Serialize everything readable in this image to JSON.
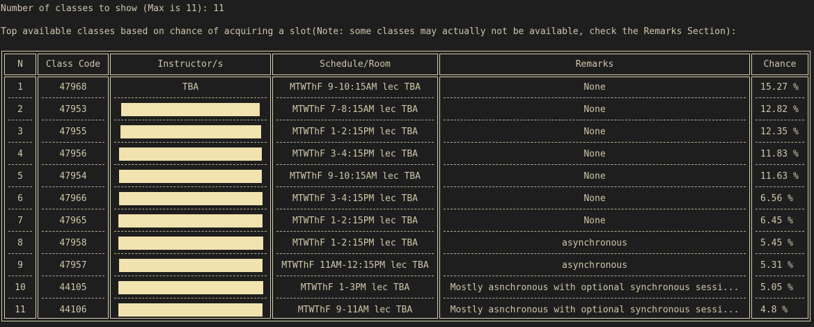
{
  "prompt": {
    "label": "Number of classes to show (Max is 11): 11"
  },
  "note": {
    "text": "Top available classes based on chance of acquiring a slot(Note: some classes may actually not be available, check the Remarks Section):"
  },
  "table": {
    "headers": [
      "N",
      "Class Code",
      "Instructor/s",
      "Schedule/Room",
      "Remarks",
      "Chance"
    ],
    "rows": [
      {
        "n": "1",
        "code": "47968",
        "instructor": "TBA",
        "instructor_redacted": false,
        "schedule": "MTWThF 9-10:15AM lec TBA",
        "remarks": "None",
        "chance": "15.27 %"
      },
      {
        "n": "2",
        "code": "47953",
        "instructor": "",
        "instructor_redacted": true,
        "schedule": "MTWThF 7-8:15AM lec TBA",
        "remarks": "None",
        "chance": "12.82 %"
      },
      {
        "n": "3",
        "code": "47955",
        "instructor": "",
        "instructor_redacted": true,
        "schedule": "MTWThF 1-2:15PM lec TBA",
        "remarks": "None",
        "chance": "12.35 %"
      },
      {
        "n": "4",
        "code": "47956",
        "instructor": "",
        "instructor_redacted": true,
        "schedule": "MTWThF 3-4:15PM lec TBA",
        "remarks": "None",
        "chance": "11.83 %"
      },
      {
        "n": "5",
        "code": "47954",
        "instructor": "",
        "instructor_redacted": true,
        "schedule": "MTWThF 9-10:15AM lec TBA",
        "remarks": "None",
        "chance": "11.63 %"
      },
      {
        "n": "6",
        "code": "47966",
        "instructor": "",
        "instructor_redacted": true,
        "schedule": "MTWThF 3-4:15PM lec TBA",
        "remarks": "None",
        "chance": "6.56 %"
      },
      {
        "n": "7",
        "code": "47965",
        "instructor": "",
        "instructor_redacted": true,
        "schedule": "MTWThF 1-2:15PM lec TBA",
        "remarks": "None",
        "chance": "6.45 %"
      },
      {
        "n": "8",
        "code": "47958",
        "instructor": "",
        "instructor_redacted": true,
        "schedule": "MTWThF 1-2:15PM lec TBA",
        "remarks": "asynchronous",
        "chance": "5.45 %"
      },
      {
        "n": "9",
        "code": "47957",
        "instructor": "",
        "instructor_redacted": true,
        "schedule": "MTWThF 11AM-12:15PM lec TBA",
        "remarks": "asynchronous",
        "chance": "5.31 %"
      },
      {
        "n": "10",
        "code": "44105",
        "instructor": "",
        "instructor_redacted": true,
        "schedule": "MTWThF 1-3PM lec TBA",
        "remarks": "Mostly asnchronous with optional synchronous sessi...",
        "chance": "5.05 %"
      },
      {
        "n": "11",
        "code": "44106",
        "instructor": "",
        "instructor_redacted": true,
        "schedule": "MTWThF 9-11AM lec TBA",
        "remarks": "Mostly asnchronous with optional synchronous sessi...",
        "chance": "4.8 %"
      }
    ]
  },
  "colors": {
    "background": "#1e1e1e",
    "text": "#cfc5a8",
    "border": "#d8cfae",
    "redaction": "#f1e3b0"
  }
}
